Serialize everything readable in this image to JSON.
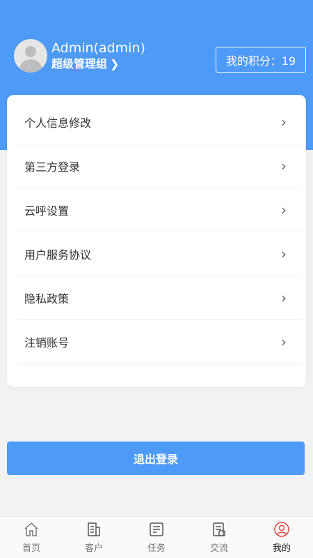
{
  "profile": {
    "name": "Admin(admin)",
    "group": "超级管理组",
    "group_chevron": "❯",
    "points_label": "我的积分：19"
  },
  "menu": [
    {
      "label": "个人信息修改",
      "arrow": "›"
    },
    {
      "label": "第三方登录",
      "arrow": "›"
    },
    {
      "label": "云呼设置",
      "arrow": "›"
    },
    {
      "label": "用户服务协议",
      "arrow": "›"
    },
    {
      "label": "隐私政策",
      "arrow": "›"
    },
    {
      "label": "注销账号",
      "arrow": "›"
    }
  ],
  "logout_label": "退出登录",
  "tabs": [
    {
      "label": "首页",
      "icon": "home-icon"
    },
    {
      "label": "客户",
      "icon": "customer-icon"
    },
    {
      "label": "任务",
      "icon": "task-icon"
    },
    {
      "label": "交流",
      "icon": "chat-icon"
    },
    {
      "label": "我的",
      "icon": "user-icon",
      "active": true
    }
  ],
  "colors": {
    "primary": "#4d9af7",
    "active_tab": "#e8453c"
  }
}
